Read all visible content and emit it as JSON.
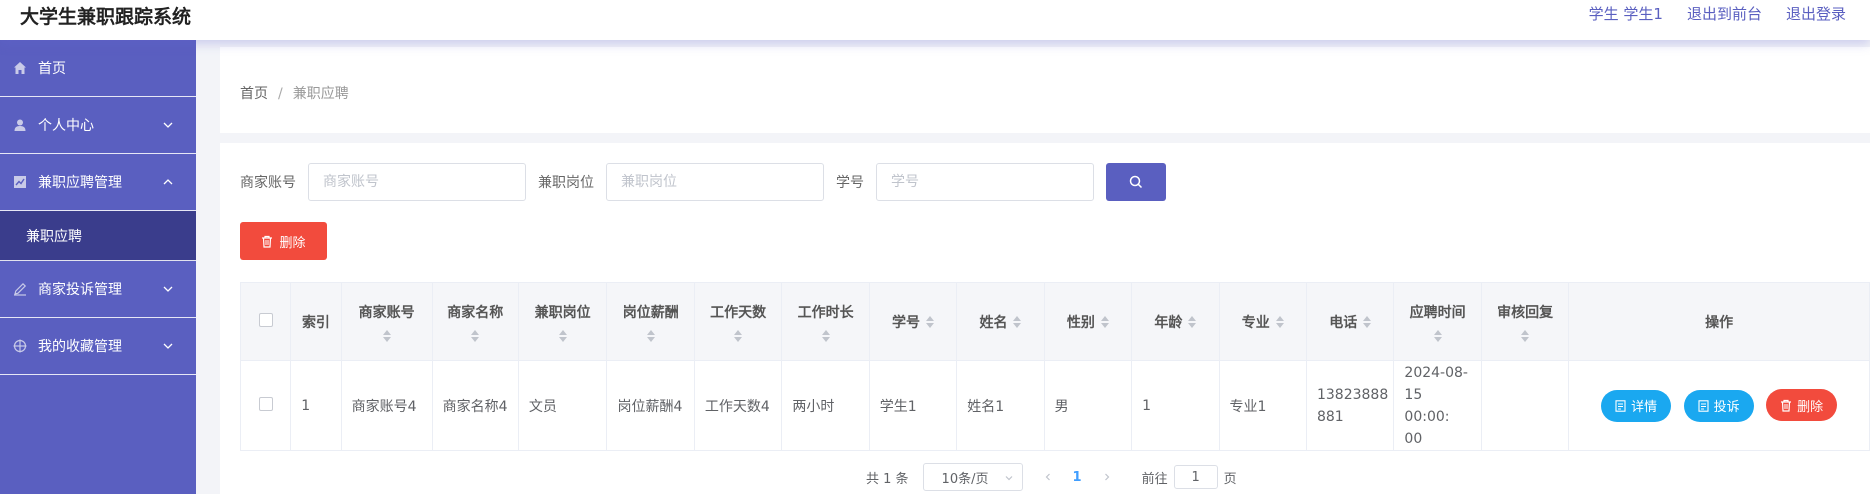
{
  "header": {
    "title": "大学生兼职跟踪系统",
    "user": "学生 学生1",
    "to_front": "退出到前台",
    "logout": "退出登录"
  },
  "sidebar": {
    "items": [
      {
        "label": "首页",
        "icon": "home-icon"
      },
      {
        "label": "个人中心",
        "icon": "user-icon",
        "expandable": true
      },
      {
        "label": "兼职应聘管理",
        "icon": "chart-icon",
        "expanded": true
      },
      {
        "label": "兼职应聘",
        "sub": true,
        "active": true
      },
      {
        "label": "商家投诉管理",
        "icon": "edit-icon",
        "expandable": true
      },
      {
        "label": "我的收藏管理",
        "icon": "target-icon",
        "expandable": true
      }
    ]
  },
  "breadcrumb": {
    "home": "首页",
    "separator": "/",
    "current": "兼职应聘"
  },
  "search": {
    "merchant_account_label": "商家账号",
    "merchant_account_placeholder": "商家账号",
    "job_position_label": "兼职岗位",
    "job_position_placeholder": "兼职岗位",
    "student_id_label": "学号",
    "student_id_placeholder": "学号"
  },
  "toolbar": {
    "delete_label": "删除"
  },
  "table": {
    "headers": {
      "index": "索引",
      "merchant_account": "商家账号",
      "merchant_name": "商家名称",
      "job_position": "兼职岗位",
      "salary": "岗位薪酬",
      "work_days": "工作天数",
      "work_hours": "工作时长",
      "student_id": "学号",
      "name": "姓名",
      "gender": "性别",
      "age": "年龄",
      "major": "专业",
      "phone": "电话",
      "apply_time": "应聘时间",
      "review_reply": "审核回复",
      "actions": "操作"
    },
    "rows": [
      {
        "index": "1",
        "merchant_account": "商家账号4",
        "merchant_name": "商家名称4",
        "job_position": "文员",
        "salary": "岗位薪酬4",
        "work_days": "工作天数4",
        "work_hours": "两小时",
        "student_id": "学生1",
        "name": "姓名1",
        "gender": "男",
        "age": "1",
        "major": "专业1",
        "phone_line1": "13823888",
        "phone_line2": "881",
        "apply_time_line1": "2024-08-",
        "apply_time_line2": "15 00:00:",
        "apply_time_line3": "00",
        "review_reply": "",
        "detail_label": "详情",
        "complain_label": "投诉",
        "delete_label": "删除"
      }
    ]
  },
  "pagination": {
    "total": "共 1 条",
    "page_size": "10条/页",
    "current_page": "1",
    "goto_label": "前往",
    "goto_value": "1",
    "page_suffix": "页"
  },
  "colors": {
    "primary": "#5a5fc0",
    "sidebar_active": "#3a3d8c",
    "danger": "#f24b3d",
    "info": "#1aa8f0"
  }
}
